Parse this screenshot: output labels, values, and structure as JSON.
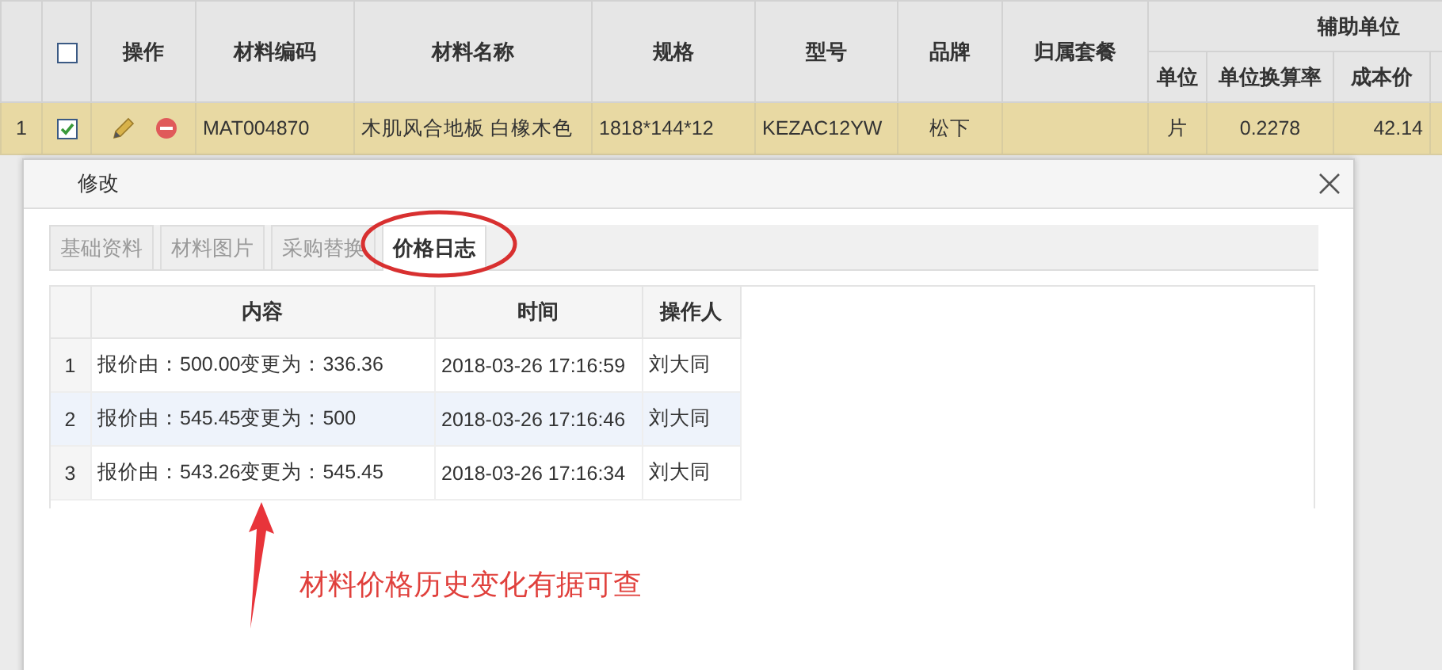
{
  "grid": {
    "select_all": {
      "checked": false
    },
    "columns": [
      "操作",
      "材料编码",
      "材料名称",
      "规格",
      "型号",
      "品牌",
      "归属套餐"
    ],
    "group_header": "辅助单位",
    "sub_columns": [
      "单位",
      "单位换算率",
      "成本价"
    ],
    "rows": [
      {
        "index": "1",
        "checked": true,
        "selected": true,
        "code": "MAT004870",
        "name": "木肌风合地板 白橡木色",
        "spec": "1818*144*12",
        "model": "KEZAC12YW",
        "brand": "松下",
        "package_name": "",
        "unit": "片",
        "rate": "0.2278",
        "cost": "42.14"
      }
    ]
  },
  "dialog": {
    "title": "修改",
    "tabs": [
      {
        "label": "基础资料",
        "selected": false
      },
      {
        "label": "材料图片",
        "selected": false
      },
      {
        "label": "采购替换",
        "selected": false
      },
      {
        "label": "价格日志",
        "selected": true
      }
    ],
    "log_table": {
      "columns": [
        "内容",
        "时间",
        "操作人"
      ],
      "rows": [
        {
          "index": "1",
          "content": "报价由：500.00变更为：336.36",
          "time": "2018-03-26 17:16:59",
          "operator": "刘大同",
          "selected": false
        },
        {
          "index": "2",
          "content": "报价由：545.45变更为：500",
          "time": "2018-03-26 17:16:46",
          "operator": "刘大同",
          "selected": true
        },
        {
          "index": "3",
          "content": "报价由：543.26变更为：545.45",
          "time": "2018-03-26 17:16:34",
          "operator": "刘大同",
          "selected": false
        }
      ]
    }
  },
  "annotation": {
    "text": "材料价格历史变化有据可查"
  }
}
